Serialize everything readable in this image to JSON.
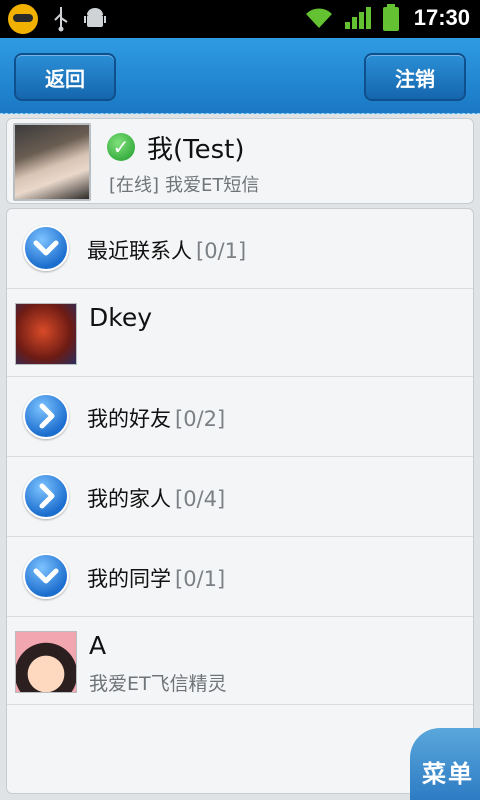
{
  "status_bar": {
    "time": "17:30",
    "icons": [
      "fetion-icon",
      "usb-icon",
      "android-icon",
      "wifi-icon",
      "signal-icon",
      "battery-icon"
    ]
  },
  "header": {
    "back_label": "返回",
    "logout_label": "注销"
  },
  "me": {
    "name": "我(Test)",
    "status_tag": "[在线]",
    "signature": "我爱ET短信"
  },
  "groups": [
    {
      "label": "最近联系人",
      "count": "[0/1]",
      "expanded": true
    },
    {
      "label": "我的好友",
      "count": "[0/2]",
      "expanded": false
    },
    {
      "label": "我的家人",
      "count": "[0/4]",
      "expanded": false
    },
    {
      "label": "我的同学",
      "count": "[0/1]",
      "expanded": true
    }
  ],
  "contacts": [
    {
      "name": "Dkey",
      "signature": ""
    },
    {
      "name": "A",
      "signature": "我爱ET飞信精灵"
    }
  ],
  "menu_label": "菜单",
  "colors": {
    "header_blue": "#1a78c5",
    "group_icon_blue": "#1d6fcf",
    "online_green": "#1e9b2b"
  }
}
